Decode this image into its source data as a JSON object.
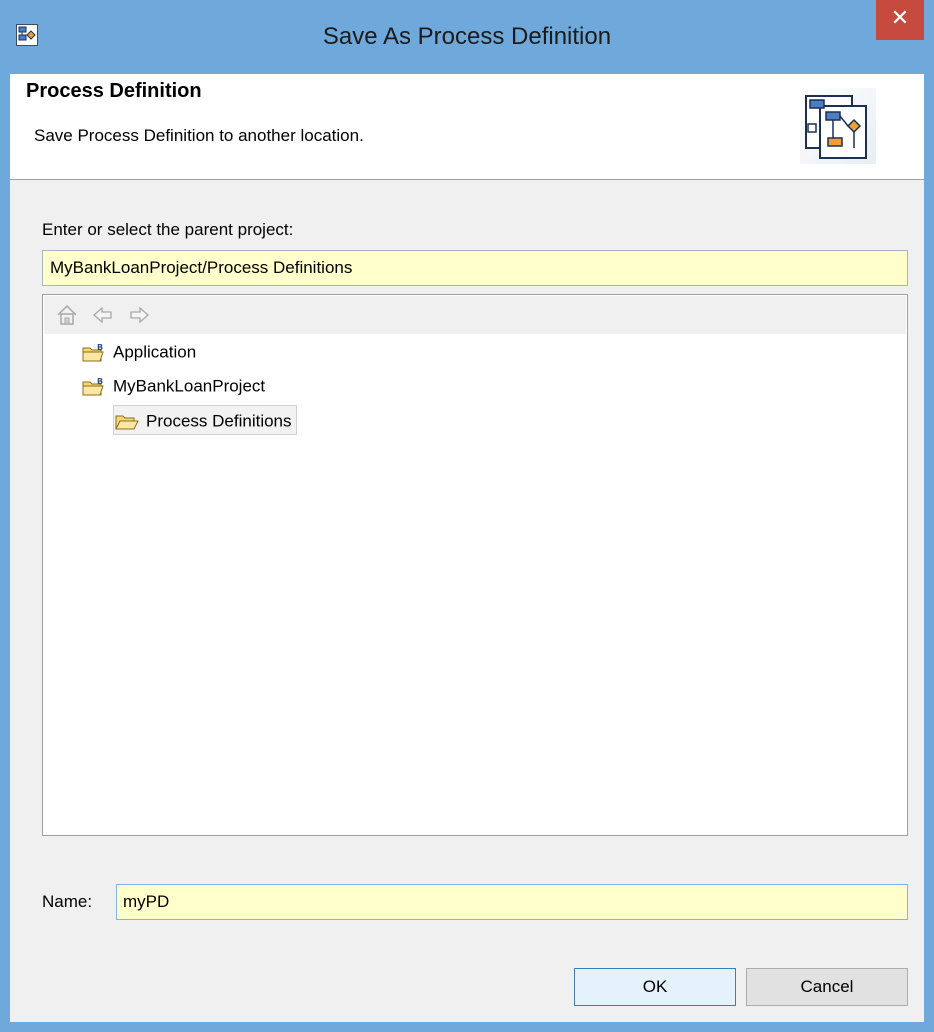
{
  "window": {
    "title": "Save As Process Definition",
    "close_symbol": "✕"
  },
  "header": {
    "title": "Process Definition",
    "description": "Save Process Definition to another location."
  },
  "parent": {
    "label": "Enter or select the parent project:",
    "value": "MyBankLoanProject/Process Definitions"
  },
  "tree": {
    "toolbar": [
      "home-icon",
      "back-arrow-icon",
      "forward-arrow-icon"
    ],
    "items": [
      {
        "label": "Application",
        "icon": "project-folder-icon",
        "level": 0,
        "selected": false
      },
      {
        "label": "MyBankLoanProject",
        "icon": "project-folder-icon",
        "level": 0,
        "selected": false
      },
      {
        "label": "Process Definitions",
        "icon": "open-folder-icon",
        "level": 1,
        "selected": true
      }
    ]
  },
  "name": {
    "label": "Name:",
    "value": "myPD"
  },
  "buttons": {
    "ok": "OK",
    "cancel": "Cancel"
  },
  "colors": {
    "title_bar": "#6fa9dc",
    "close_button": "#c74a3e",
    "input_background": "#ffffcc",
    "dialog_background": "#f0f0f0"
  }
}
